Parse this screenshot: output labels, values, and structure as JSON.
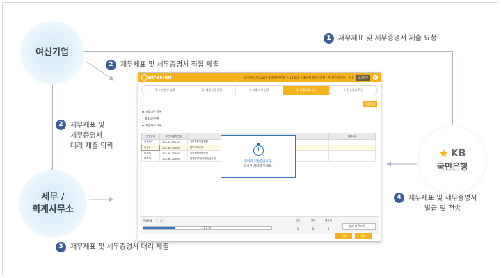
{
  "nodes": {
    "company": "여신기업",
    "tax_office": "세무 /\n회계사무소",
    "bank_brand": "KB",
    "bank_name": "국민은행"
  },
  "steps": [
    {
      "num": "1",
      "text": "재무제표 및 세무증명서 제출 요청"
    },
    {
      "num": "2",
      "text": "재무제표 및 세무증명서 직접 제출"
    },
    {
      "num": "2",
      "text": "재무제표 및\n세무증명서\n대리 제출 의뢰"
    },
    {
      "num": "3",
      "text": "재무제표 및 세무증명서 대리 제출"
    },
    {
      "num": "4",
      "text": "재무제표 및 세무증명서\n발급 및 전송"
    }
  ],
  "colors": {
    "accent": "#f4b21c",
    "step_badge": "#3f5d9a",
    "node_blue": "#e3f1fa",
    "modal_border": "#2e73b8"
  },
  "app": {
    "brand": "uickFind",
    "topbar": {
      "phone": "고객센터 02) 3279-4509 (09:00 ~ 18:00)",
      "user": "(재)스티 법인사업자 · 본사기업체아이 ( 주 )",
      "logout": "로그아웃"
    },
    "wizard_steps": [
      "1. 기본정보 입력",
      "2. 제출기관 선택",
      "3. 제출자료 선택",
      "4. 제출자료 전송",
      "5. 전송결과 확인"
    ],
    "active_step": 3,
    "corner_button": "제출방법",
    "section1": "제출기관 목록",
    "institution": "KB국민은행",
    "section2": "제출자료 목록",
    "table": {
      "headers": [
        "진행상태",
        "주민/사업자번호",
        "",
        "실패사유"
      ],
      "rows": [
        {
          "status": "전송완료",
          "id": "105-86-75000",
          "doc": "사업자등록증명원"
        },
        {
          "status": "전송중",
          "id": "105-86-75000",
          "doc": "납부내역증명"
        },
        {
          "status": "미처리",
          "id": "105-86-75000",
          "doc": "지방세납세증명서"
        },
        {
          "status": "미처리",
          "id": "105-86-75000",
          "doc": "납세증명서(국세완납증명)"
        }
      ]
    },
    "modal": {
      "line1": "데이터 전송중입니다.",
      "line2": "잠시만 기다려 주세요."
    },
    "footer": {
      "progress_label": "진행현황 ( 1 / 4 )",
      "progress": 0.25,
      "progress_text": "25 %",
      "counts": [
        {
          "label": "성공",
          "value": "1"
        },
        {
          "label": "실패",
          "value": "0"
        },
        {
          "label": "대상외",
          "value": "0"
        }
      ],
      "detail_button": "실패 자료보기"
    },
    "buttons": {
      "submit": "전진",
      "close": "종료"
    }
  }
}
